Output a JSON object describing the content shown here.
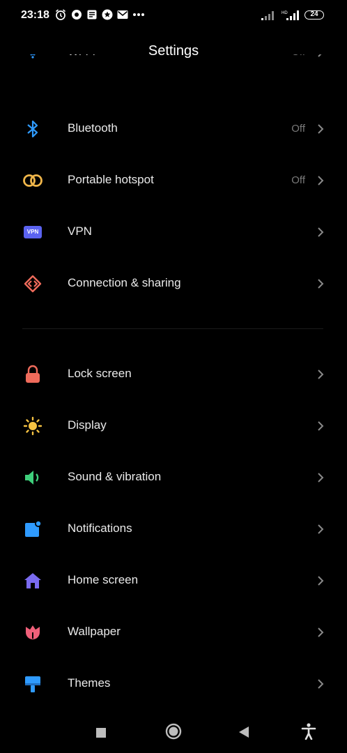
{
  "status": {
    "time": "23:18",
    "battery": "24"
  },
  "header": {
    "title": "Settings"
  },
  "items_top": [
    {
      "id": "wifi",
      "label": "Wi-Fi",
      "value": "Off",
      "icon": "wifi-icon"
    },
    {
      "id": "bluetooth",
      "label": "Bluetooth",
      "value": "Off",
      "icon": "bluetooth-icon"
    },
    {
      "id": "hotspot",
      "label": "Portable hotspot",
      "value": "Off",
      "icon": "hotspot-icon"
    },
    {
      "id": "vpn",
      "label": "VPN",
      "value": "",
      "icon": "vpn-icon",
      "icon_text": "VPN"
    },
    {
      "id": "connection",
      "label": "Connection & sharing",
      "value": "",
      "icon": "connection-sharing-icon"
    }
  ],
  "items_bottom": [
    {
      "id": "lock",
      "label": "Lock screen",
      "icon": "lock-icon"
    },
    {
      "id": "display",
      "label": "Display",
      "icon": "sun-icon"
    },
    {
      "id": "sound",
      "label": "Sound & vibration",
      "icon": "speaker-icon"
    },
    {
      "id": "notifications",
      "label": "Notifications",
      "icon": "notification-icon"
    },
    {
      "id": "home",
      "label": "Home screen",
      "icon": "home-icon"
    },
    {
      "id": "wallpaper",
      "label": "Wallpaper",
      "icon": "tulip-icon"
    },
    {
      "id": "themes",
      "label": "Themes",
      "icon": "paint-brush-icon"
    }
  ],
  "colors": {
    "wifi": "#2f9bff",
    "bluetooth": "#2f9bff",
    "hotspot": "#f0b64a",
    "vpn": "#5b63f0",
    "connection": "#ef6b5b",
    "lock": "#ef6b5b",
    "display": "#f5c242",
    "sound": "#3ecf7b",
    "notifications": "#2f9bff",
    "home": "#7a6bf0",
    "wallpaper": "#f0607a",
    "themes": "#2f9bff"
  },
  "navbar": {
    "icons": [
      "recents-square-icon",
      "home-circle-icon",
      "back-triangle-icon",
      "accessibility-icon"
    ]
  }
}
